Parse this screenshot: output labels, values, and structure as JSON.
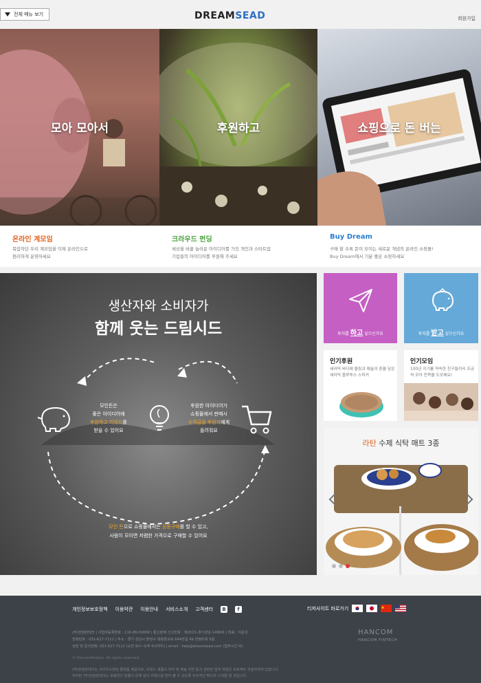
{
  "header": {
    "menu_label": "전체 메뉴 보기",
    "logo_part1": "DREAM",
    "logo_part2": "SEAD",
    "signup": "회원가입"
  },
  "hero": [
    {
      "title": "모아 모아서",
      "subtitle": "온라인 계모임",
      "subtitle_color": "#e2621c",
      "desc": [
        "복잡하던 우리 계모임을 이제 온라인으로",
        "편리하게 운영하세요"
      ]
    },
    {
      "title": "후원하고",
      "subtitle": "크라우드 펀딩",
      "subtitle_color": "#4aa03d",
      "desc": [
        "세상을 바꿀 놀라운 아이디어를 가진 개인과 스타트업",
        "기업들의 아이디어를 후원해 주세요"
      ]
    },
    {
      "title": "쇼핑으로 돈 버는",
      "subtitle": "Buy Dream",
      "subtitle_color": "#2b7fd0",
      "desc": [
        "구매 할 수록 돈이 모이는 새로운 개념의 온라인 쇼핑몰!",
        "Buy Dream에서 기분 좋은 쇼핑하세요"
      ]
    }
  ],
  "promo": {
    "headline1": "생산자와 소비자가",
    "headline2": "함께 웃는 드림시드",
    "left_text": [
      "모인돈은",
      "좋은 아이디어에"
    ],
    "left_highlight": "후원하고 리워드",
    "left_after": "를",
    "left_end": "받을 수 있어요",
    "right_text": [
      "후원한 아이디어가",
      "쇼핑몰에서 판매시"
    ],
    "right_highlight": "수익금을 후원자",
    "right_after": "에게",
    "right_end": "돌려줘요",
    "bottom_hl": "모인 돈",
    "bottom_a": "으로 쇼핑몰에서는 ",
    "bottom_hl2": "공동구매",
    "bottom_b": "를 할 수 있고,",
    "bottom_line2": "사람이 모이면 저렴한 가격으로 구매할 수 있어요"
  },
  "tiles": {
    "give_pre": "투자를 ",
    "give_em": "하고",
    "give_post": " 싶으신가요",
    "get_pre": "투자를 ",
    "get_em": "받고",
    "get_post": " 싶으신가요"
  },
  "cards": {
    "support_title": "인기후원",
    "support_desc": "세라믹 바디에 울림과 예술의 혼을 담은 세라믹 블루투스 스피커",
    "meet_title": "인기모임",
    "meet_desc": "100년 지기를 약속한 친구들끼리 조금씩 모아 친목을 도모해요!"
  },
  "showcase": {
    "title_hl": "라탄",
    "title_rest": " 수제 식탁 매트 3종"
  },
  "footer": {
    "nav": [
      "개인정보보호정책",
      "이용약관",
      "이용안내",
      "서비스소개",
      "고객센터"
    ],
    "sites_label": "티저사이트 바로가기",
    "info": [
      "(주)한컴핀테크 | 사업자등록번호 : 116-86-00069 | 통신판매 신고번호 : 제2015-경기성남-1496호 | 대표 : 지윤성",
      "전화번호 : 031-627-7112 | 주소 : 경기 성남시 분당구 대왕판교로 644번길 49 한컴타워 5층",
      "상담 및 문의전화: 031-627-7112 (오전 9시~오후 6시까지) | email : help@dreamsead.com (업무시간 외)"
    ],
    "copyright": "© Hancomfintech. All rights reserved.",
    "note": [
      "(주)한컴핀테크는 크라우드펀딩 플랫폼 제공자로, 리워드 제품의 하자 및 배송 지연 등과 관련된 법적 책임은 프로젝트 개설자에게 있습니다.",
      "하지만 (주)한컴핀테크는 보람찬다 분들이 문제 없이 리워드를 받아 볼 수 있도록 지속적인 확인과 노력을 할 것입니다."
    ],
    "brand": "HANCOM",
    "brand_sub": "HANCOM FINTECH"
  }
}
